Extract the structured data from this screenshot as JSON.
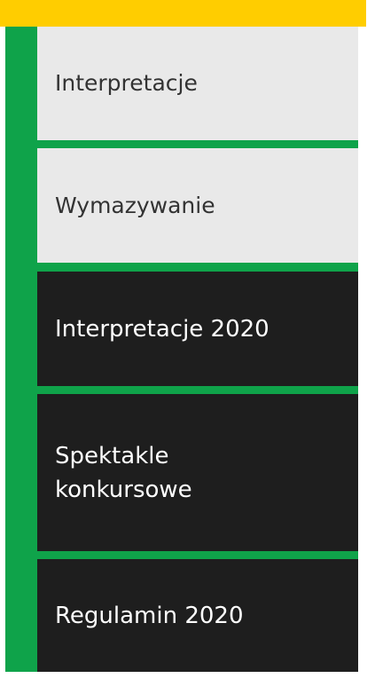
{
  "colors": {
    "accent_yellow": "#ffcd00",
    "menu_green": "#0fa34a",
    "light_item_bg": "#e9e9e9",
    "dark_item_bg": "#1e1e1e"
  },
  "menu": {
    "items": [
      {
        "label": "Interpretacje",
        "style": "light"
      },
      {
        "label": "Wymazywanie",
        "style": "light"
      },
      {
        "label": "Interpretacje 2020",
        "style": "dark"
      },
      {
        "label": "Spektakle konkursowe",
        "style": "dark"
      },
      {
        "label": "Regulamin 2020",
        "style": "dark"
      }
    ]
  }
}
